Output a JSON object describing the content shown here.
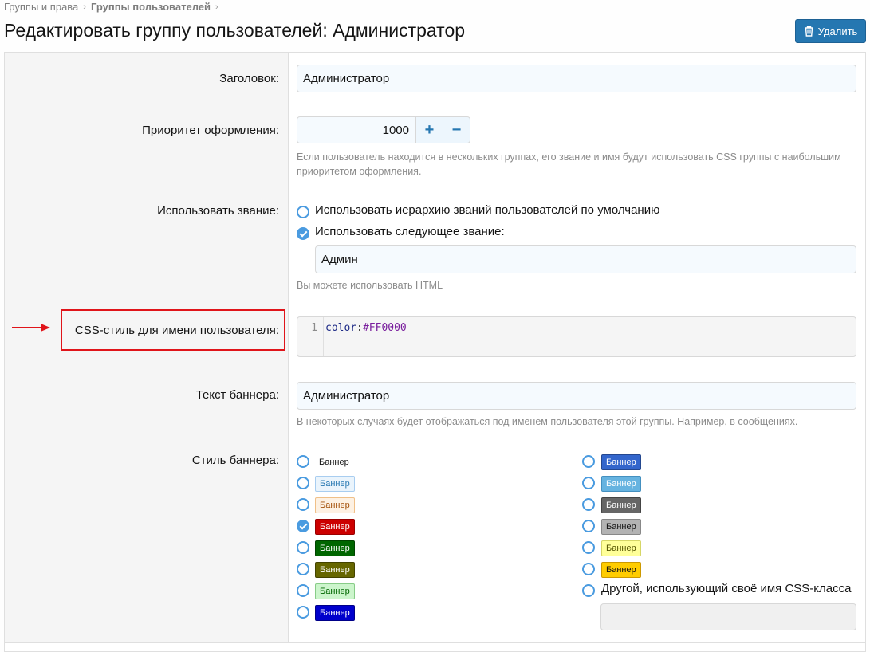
{
  "breadcrumb": {
    "root": "Группы и права",
    "current": "Группы пользователей",
    "separator": "›"
  },
  "header": {
    "title": "Редактировать группу пользователей: Администратор",
    "delete_label": "Удалить"
  },
  "form": {
    "title_label": "Заголовок:",
    "title_value": "Администратор",
    "priority_label": "Приоритет оформления:",
    "priority_value": "1000",
    "priority_plus": "+",
    "priority_minus": "−",
    "priority_hint": "Если пользователь находится в нескольких группах, его звание и имя будут использовать CSS группы с наибольшим приоритетом оформления.",
    "rank_label": "Использовать звание:",
    "rank_option_default": "Использовать иерархию званий пользователей по умолчанию",
    "rank_option_custom": "Использовать следующее звание:",
    "rank_value": "Админ",
    "rank_hint": "Вы можете использовать HTML",
    "css_label": "CSS-стиль для имени пользователя:",
    "css_line_number": "1",
    "css_property": "color",
    "css_colon": ":",
    "css_value": "#FF0000",
    "banner_text_label": "Текст баннера:",
    "banner_text_value": "Администратор",
    "banner_text_hint": "В некоторых случаях будет отображаться под именем пользователя этой группы. Например, в сообщениях.",
    "banner_style_label": "Стиль баннера:",
    "banner_word": "Баннер",
    "other_class_label": "Другой, использующий своё имя CSS-класса",
    "selected_banner": "red"
  },
  "colors": {
    "accent": "#2577b1",
    "radio": "#4a9be0",
    "annotation": "#e0141a"
  }
}
